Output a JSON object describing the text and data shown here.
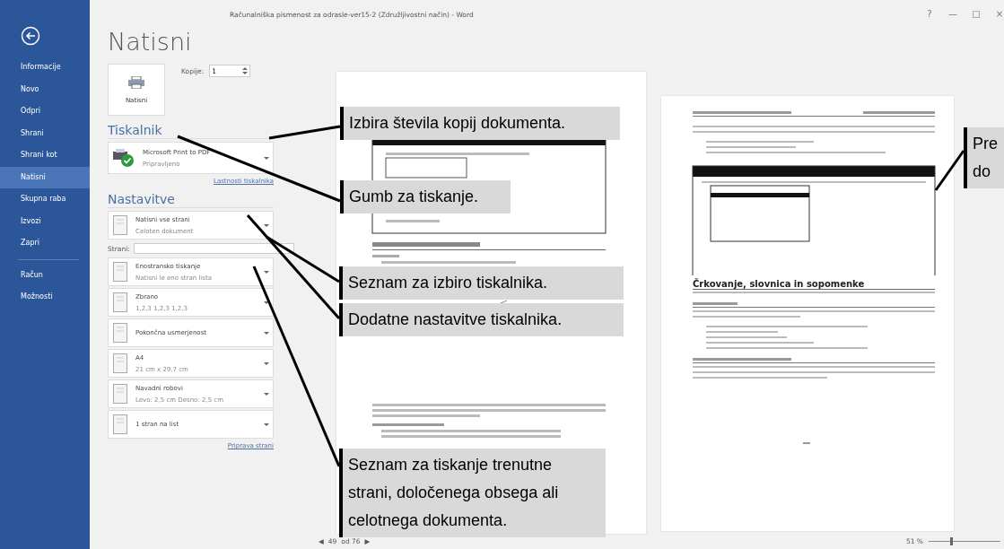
{
  "window": {
    "title": "Računalniška pismenost za odrasle-ver15-2 (Združljivostni način) - Word",
    "controls": [
      "?",
      "—",
      "□",
      "×"
    ]
  },
  "sidebar": {
    "items": [
      {
        "label": "Informacije",
        "selected": false
      },
      {
        "label": "Novo",
        "selected": false
      },
      {
        "label": "Odpri",
        "selected": false
      },
      {
        "label": "Shrani",
        "selected": false
      },
      {
        "label": "Shrani kot",
        "selected": false
      },
      {
        "label": "Natisni",
        "selected": true
      },
      {
        "label": "Skupna raba",
        "selected": false
      },
      {
        "label": "Izvozi",
        "selected": false
      },
      {
        "label": "Zapri",
        "selected": false
      }
    ],
    "bottom_items": [
      {
        "label": "Račun",
        "selected": false
      },
      {
        "label": "Možnosti",
        "selected": false
      }
    ]
  },
  "print": {
    "title": "Natisni",
    "button": "Natisni",
    "copies_label": "Kopije:",
    "copies_value": "1"
  },
  "printer": {
    "heading": "Tiskalnik",
    "name": "Microsoft Print to PDF",
    "status": "Pripravljeno",
    "properties_link": "Lastnosti tiskalnika"
  },
  "settings": {
    "heading": "Nastavitve",
    "items": [
      {
        "kind": "dropdown",
        "title": "Natisni vse strani",
        "subtitle": "Celoten dokument"
      },
      {
        "kind": "field",
        "label": "Strani:"
      },
      {
        "kind": "dropdown",
        "title": "Enostransko tiskanje",
        "subtitle": "Natisni le eno stran lista"
      },
      {
        "kind": "dropdown",
        "title": "Zbrano",
        "subtitle": "1,2,3    1,2,3    1,2,3"
      },
      {
        "kind": "dropdown",
        "title": "Pokončna usmerjenost"
      },
      {
        "kind": "dropdown",
        "title": "A4",
        "subtitle": "21 cm x 29,7 cm"
      },
      {
        "kind": "dropdown",
        "title": "Navadni robovi",
        "subtitle": "Levo: 2,5 cm   Desno: 2,5 cm"
      },
      {
        "kind": "dropdown",
        "title": "1 stran na list"
      }
    ],
    "page_setup_link": "Priprava strani"
  },
  "preview": {
    "right_page_heading": "Črkovanje, slovnica in sopomenke",
    "page_number": "49",
    "page_total": "od 76",
    "prev": "◀",
    "next": "▶",
    "zoom": "51 %",
    "zoom_slider": {
      "level": 0.3
    }
  },
  "callouts": [
    {
      "text": "Izbira števila kopij dokumenta."
    },
    {
      "text": "Gumb za tiskanje."
    },
    {
      "text": "Seznam za izbiro tiskalnika."
    },
    {
      "text": "Dodatne nastavitve tiskalnika."
    },
    {
      "text": "Seznam za tiskanje trenutne strani, določenega obsega ali celotnega dokumenta."
    },
    {
      "text": "Pre\ndo"
    }
  ]
}
